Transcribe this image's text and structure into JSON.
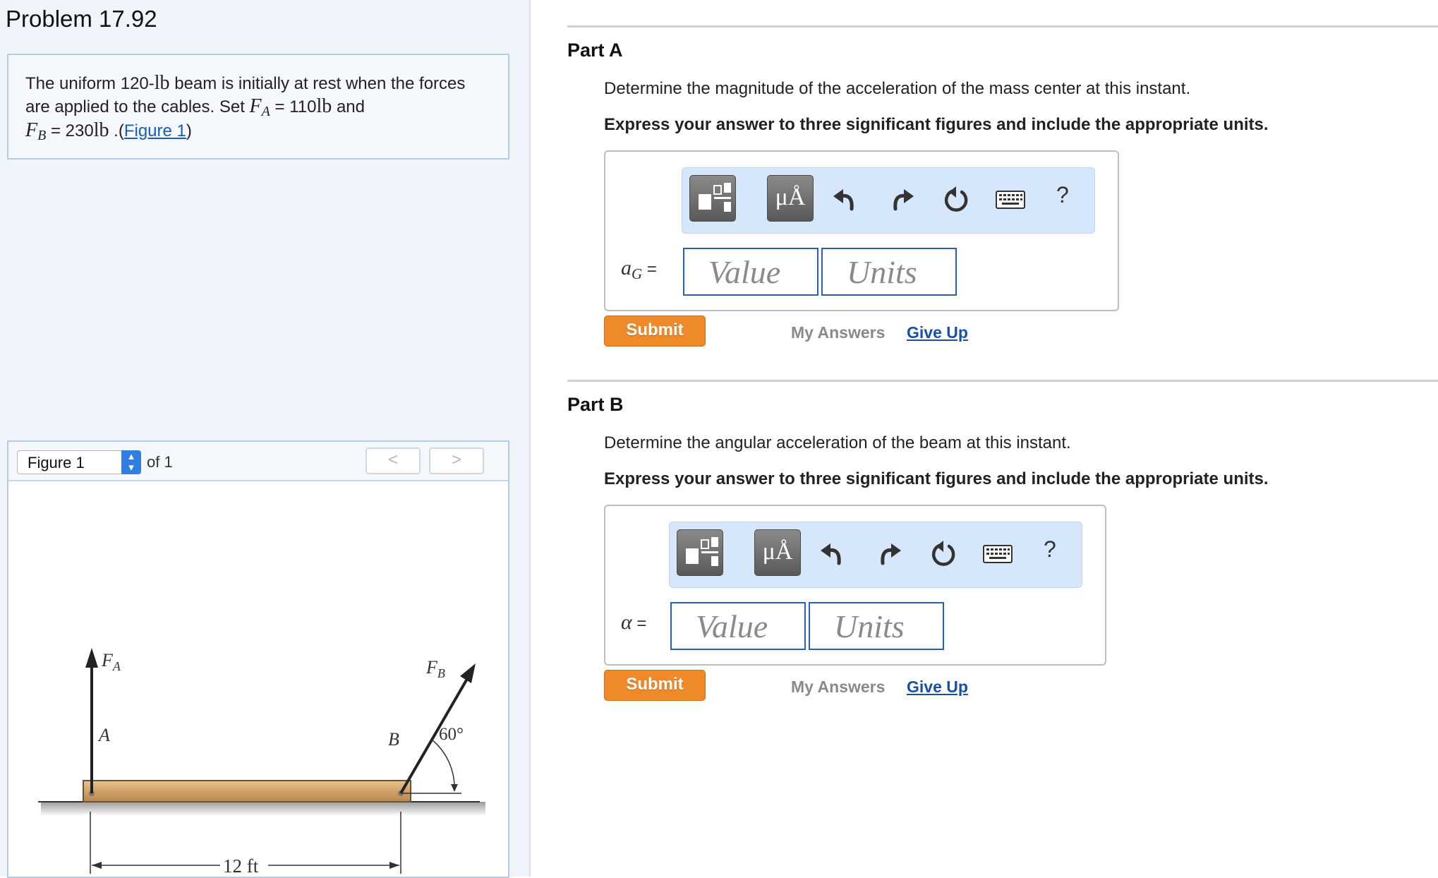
{
  "problem": {
    "title": "Problem 17.92",
    "text_1": "The uniform 120-",
    "weight_unit": "lb",
    "text_2": " beam is initially at rest when the forces are applied to the cables. Set ",
    "fa_symbol": "F",
    "fa_sub": "A",
    "fa_eq": " = 110",
    "fa_unit": "lb",
    "text_3": " and ",
    "fb_symbol": "F",
    "fb_sub": "B",
    "fb_eq": " = 230",
    "fb_unit": "lb",
    "text_4": " .(",
    "figure_link": "Figure 1",
    "text_5": ")"
  },
  "figure_panel": {
    "select_value": "Figure 1",
    "of_label": "of 1",
    "prev_icon": "chevron-left-icon",
    "next_icon": "chevron-right-icon",
    "prev_glyph": "<",
    "next_glyph": ">",
    "labels": {
      "fa_main": "F",
      "fa_sub": "A",
      "fb_main": "F",
      "fb_sub": "B",
      "a": "A",
      "b": "B",
      "angle": "60°",
      "length": "12 ft"
    }
  },
  "toolbar": {
    "units_button": "μÅ",
    "template_icon": "fraction-template-icon",
    "undo_icon": "undo-icon",
    "redo_icon": "redo-icon",
    "reset_icon": "reset-icon",
    "keyboard_icon": "keyboard-icon",
    "help": "?"
  },
  "parts": [
    {
      "title": "Part A",
      "question": "Determine the magnitude of the acceleration of the mass center at this instant.",
      "instruction": "Express your answer to three significant figures and include the appropriate units.",
      "var_symbol": "a",
      "var_sub": "G",
      "var_eq": " =",
      "value_placeholder": "Value",
      "units_placeholder": "Units",
      "submit": "Submit",
      "my_answers": "My Answers",
      "give_up": "Give Up"
    },
    {
      "title": "Part B",
      "question": "Determine the angular acceleration of the beam at this instant.",
      "instruction": "Express your answer to three significant figures and include the appropriate units.",
      "var_symbol": "α",
      "var_eq": " =",
      "value_placeholder": "Value",
      "units_placeholder": "Units",
      "submit": "Submit",
      "my_answers": "My Answers",
      "give_up": "Give Up"
    }
  ],
  "colors": {
    "submit_bg": "#ef8a2a",
    "link": "#1a4fa8",
    "toolbar_bg": "#d6e6fb",
    "field_border": "#2a5fb0",
    "left_panel_bg": "#f0f5fc"
  }
}
